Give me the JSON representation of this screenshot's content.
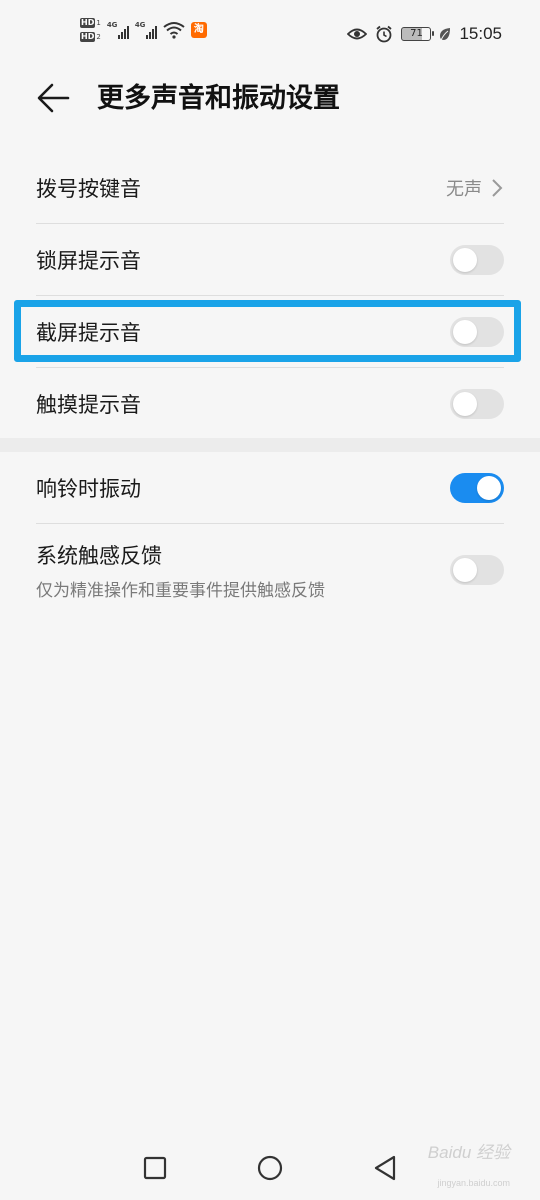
{
  "status_bar": {
    "hd1": "HD",
    "hd1_num": "1",
    "hd2": "HD",
    "hd2_num": "2",
    "sig1_label": "4G",
    "sig2_label": "4G",
    "app_badge": "淘",
    "battery": "71",
    "time": "15:05"
  },
  "header": {
    "title": "更多声音和振动设置"
  },
  "group1": [
    {
      "label": "拨号按键音",
      "value": "无声"
    },
    {
      "label": "锁屏提示音",
      "toggle": false
    },
    {
      "label": "截屏提示音",
      "toggle": false
    },
    {
      "label": "触摸提示音",
      "toggle": false
    }
  ],
  "group2": [
    {
      "label": "响铃时振动",
      "toggle": true
    },
    {
      "label": "系统触感反馈",
      "sublabel": "仅为精准操作和重要事件提供触感反馈",
      "toggle": false
    }
  ],
  "watermark": {
    "text": "Baidu 经验",
    "sub": "jingyan.baidu.com"
  },
  "colors": {
    "accent": "#1a8cf0",
    "highlight": "#1aa3e8",
    "taobao": "#ff6a00"
  }
}
